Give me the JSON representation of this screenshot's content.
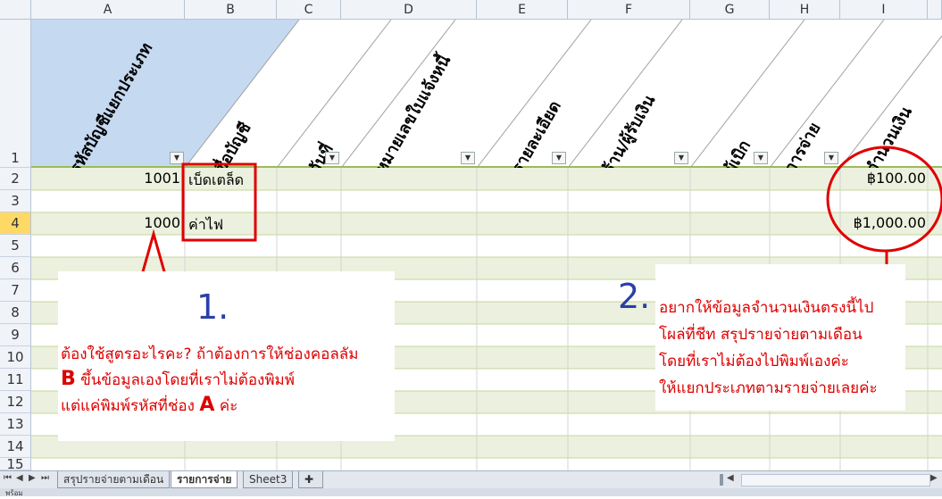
{
  "columns": [
    "A",
    "B",
    "C",
    "D",
    "E",
    "F",
    "G",
    "H",
    "I"
  ],
  "rows": [
    "1",
    "2",
    "3",
    "4",
    "5",
    "6",
    "7",
    "8",
    "9",
    "10",
    "11",
    "12",
    "13",
    "14",
    "15"
  ],
  "headers": {
    "a": "รหัสบัญชีแยกประเภท",
    "b": "ชื่อบัญชี",
    "c": "วันที่",
    "d": "หมายเลขใบแจ้งหนี้",
    "e": "รายละเอียด",
    "f": "ร้าน/ผู้รับเงิน",
    "g": "ผู้เบิก",
    "h": "การจ่าย",
    "i": "จำนวนเงิน"
  },
  "data": {
    "r2_code": "1001",
    "r2_name": "เบ็ดเตล็ด",
    "r2_amount": "฿100.00",
    "r4_code": "1000",
    "r4_name": "ค่าไฟ",
    "r4_amount": "฿1,000.00"
  },
  "notes": {
    "num1": "1.",
    "note1_l1": "ต้องใช้สูตรอะไรคะ? ถ้าต้องการให้ช่องคอลลัม",
    "note1_l2_b": "B",
    "note1_l2": " ขึ้นข้อมูลเองโดยที่เราไม่ต้องพิมพ์",
    "note1_l3": "แต่แค่พิมพ์รหัสที่ช่อง ",
    "note1_l3_a": "A",
    "note1_l3_end": " ค่ะ",
    "num2": "2.",
    "note2_l1": "อยากให้ข้อมูลจำนวนเงินตรงนี้ไป",
    "note2_l2": "โผล่ที่ชีท สรุปรายจ่ายตามเดือน",
    "note2_l3": "โดยที่เราไม่ต้องไปพิมพ์เองค่ะ",
    "note2_l4": "ให้แยกประเภทตามรายจ่ายเลยค่ะ"
  },
  "tabs": [
    "สรุปรายจ่ายตามเดือน",
    "รายการจ่าย",
    "Sheet3"
  ],
  "status": "พร้อม",
  "colors": {
    "annotation": "#e00000",
    "band": "#ebf1de",
    "header_fill": "#c5d9f1",
    "number": "#2b3fa8"
  }
}
